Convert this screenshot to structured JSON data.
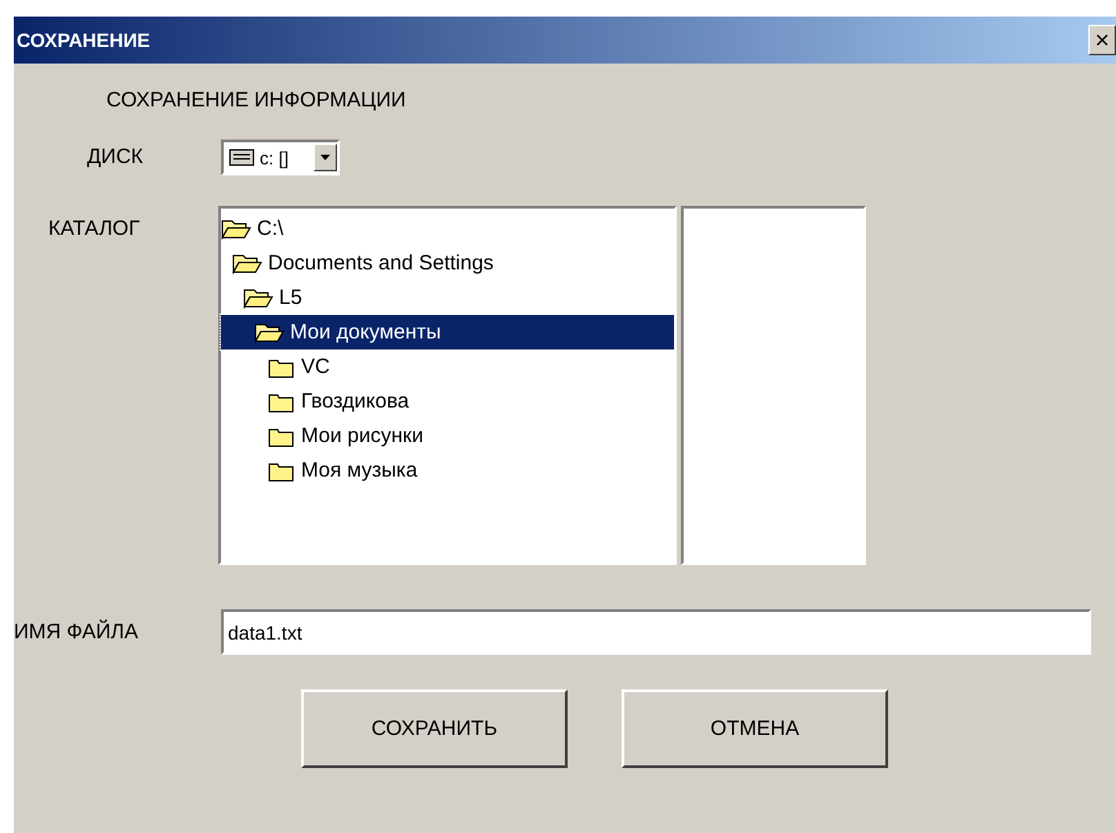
{
  "window": {
    "title": "СОХРАНЕНИЕ",
    "close": "×"
  },
  "heading": "СОХРАНЕНИЕ ИНФОРМАЦИИ",
  "drive": {
    "label": "ДИСК",
    "value": "c: []"
  },
  "catalog": {
    "label": "КАТАЛОГ",
    "tree": [
      {
        "name": "C:\\",
        "expanded": true,
        "selected": false,
        "children": [
          {
            "name": "Documents and Settings",
            "expanded": true,
            "selected": false,
            "children": [
              {
                "name": "L5",
                "expanded": true,
                "selected": false,
                "children": [
                  {
                    "name": "Мои документы",
                    "expanded": true,
                    "selected": true,
                    "children": [
                      {
                        "name": "VC",
                        "expanded": false,
                        "selected": false
                      },
                      {
                        "name": "Гвоздикова",
                        "expanded": false,
                        "selected": false
                      },
                      {
                        "name": "Мои рисунки",
                        "expanded": false,
                        "selected": false
                      },
                      {
                        "name": "Моя музыка",
                        "expanded": false,
                        "selected": false
                      }
                    ]
                  }
                ]
              }
            ]
          }
        ]
      }
    ]
  },
  "filename": {
    "label": "ИМЯ ФАЙЛА",
    "value": "data1.txt"
  },
  "buttons": [
    "СОХРАНИТЬ",
    "ОТМЕНА"
  ]
}
